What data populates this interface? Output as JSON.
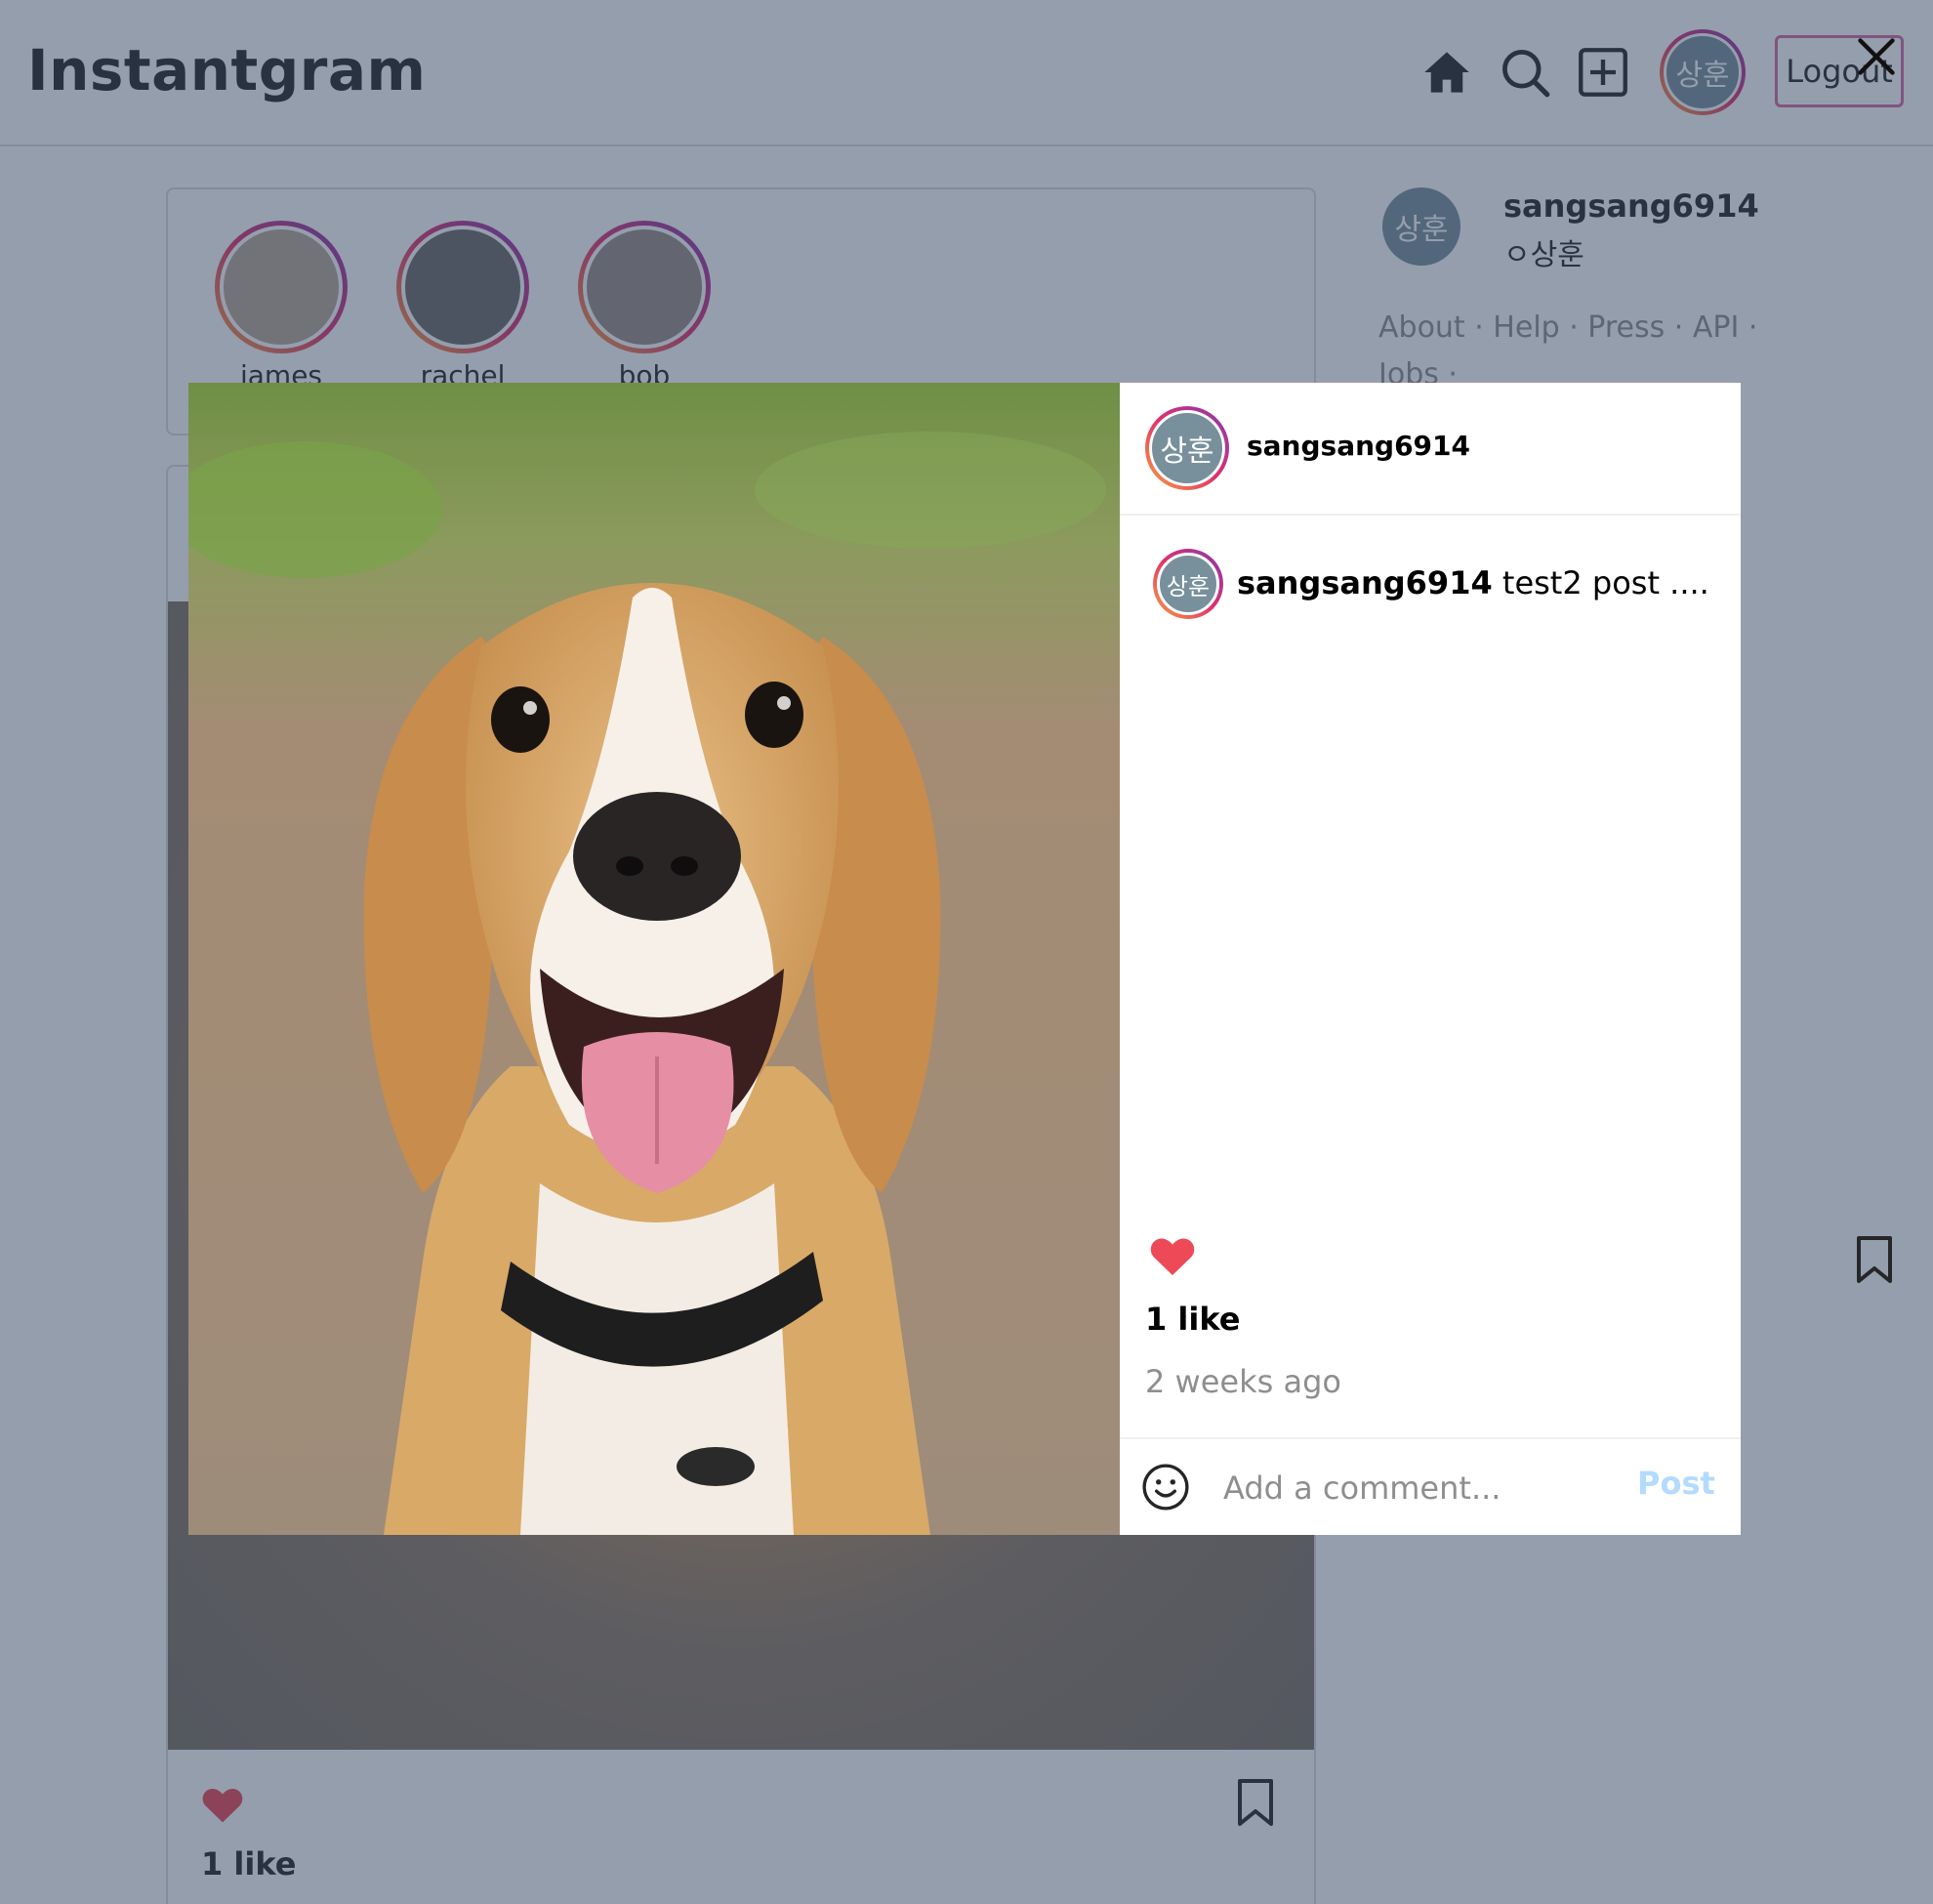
{
  "navbar": {
    "logo": "Instantgram",
    "avatar_text": "상훈",
    "logout_label": "Logout"
  },
  "stories": [
    {
      "name": "james"
    },
    {
      "name": "rachel"
    },
    {
      "name": "bob"
    }
  ],
  "sidebar": {
    "avatar_text": "상훈",
    "username": "sangsang6914",
    "name": "ㅇ상훈",
    "links": "About · Help · Press · API · Jobs ·"
  },
  "feed_post": {
    "likes": "1 like"
  },
  "modal": {
    "header": {
      "avatar_text": "상훈",
      "username": "sangsang6914"
    },
    "caption": {
      "avatar_text": "상훈",
      "username": "sangsang6914",
      "text": " test2 post ...."
    },
    "liked": true,
    "likes": "1 like",
    "time": "2 weeks ago",
    "comment_placeholder": "Add a comment...",
    "post_label": "Post"
  },
  "colors": {
    "heart": "#ed4956",
    "post_button_disabled": "#b3dbff",
    "avatar_bg": "#78909c"
  },
  "icons": [
    "home-icon",
    "search-icon",
    "new-post-icon",
    "close-icon",
    "heart-icon",
    "bookmark-icon",
    "emoji-icon"
  ]
}
